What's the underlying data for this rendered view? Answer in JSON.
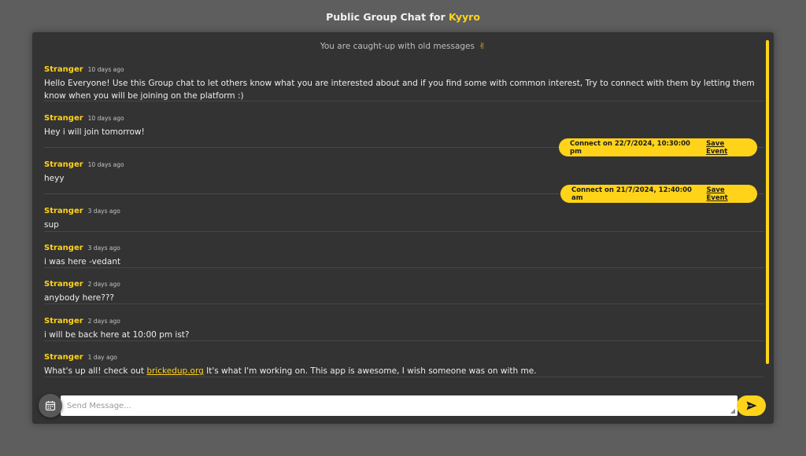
{
  "header": {
    "title_prefix": "Public Group Chat for ",
    "brand": "Kyyro"
  },
  "chat": {
    "caught_up_text": "You are caught-up with old messages",
    "caught_up_emoji": "✌",
    "messages": [
      {
        "user": "Stranger",
        "time": "10 days ago",
        "text": "Hello Everyone! Use this Group chat to let others know what you are interested about and if you find some with common interest, Try to connect with them by letting them know when you will be joining on the platform :)"
      },
      {
        "user": "Stranger",
        "time": "10 days ago",
        "text": "Hey i will join tomorrow!"
      },
      {
        "user": "Stranger",
        "time": "10 days ago",
        "text": "heyy"
      },
      {
        "user": "Stranger",
        "time": "3 days ago",
        "text": "sup"
      },
      {
        "user": "Stranger",
        "time": "3 days ago",
        "text": "i was here -vedant"
      },
      {
        "user": "Stranger",
        "time": "2 days ago",
        "text": "anybody here???"
      },
      {
        "user": "Stranger",
        "time": "2 days ago",
        "text": "i will be back here at 10:00 pm ist?"
      },
      {
        "user": "Stranger",
        "time": "1 day ago",
        "text_before": "What's up all! check out ",
        "link": "brickedup.org",
        "text_after": " It's what I'm working on. This app is awesome, I wish someone was on with me."
      }
    ],
    "events": [
      {
        "label": "Connect on 22/7/2024, 10:30:00 pm",
        "action": "Save Event"
      },
      {
        "label": "Connect on 21/7/2024, 12:40:00 am",
        "action": "Save Event"
      }
    ]
  },
  "composer": {
    "placeholder": "Send Message...",
    "calendar_icon": "calendar-icon",
    "send_icon": "send-icon"
  },
  "colors": {
    "accent": "#ffd31a",
    "panel": "#333333",
    "background": "#5e5e5e"
  }
}
